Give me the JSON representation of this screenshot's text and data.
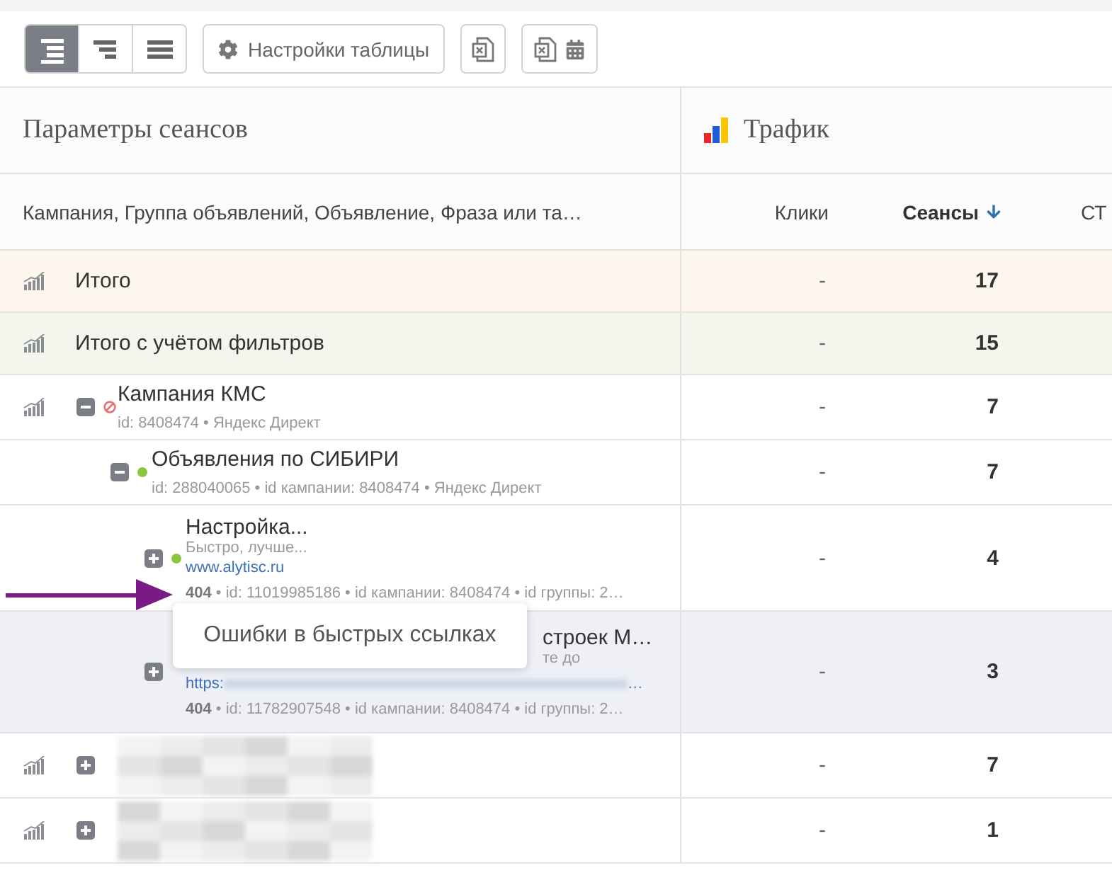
{
  "toolbar": {
    "view_modes": [
      {
        "kind": "tree",
        "selected": true
      },
      {
        "kind": "stepped",
        "selected": false
      },
      {
        "kind": "flat",
        "selected": false
      }
    ],
    "settings_button": "Настройки таблицы",
    "exports": [
      {
        "kind": "excel"
      },
      {
        "kind": "excel_schedule"
      }
    ]
  },
  "table": {
    "group_headers": [
      {
        "kind": "params",
        "label": "Параметры сеансов"
      },
      {
        "kind": "traffic",
        "label": "Трафик"
      }
    ],
    "columns": [
      {
        "label": "Кампания, Группа объявлений, Объявление, Фраза или та…",
        "sorted": false
      },
      {
        "label": "Клики",
        "sorted": false
      },
      {
        "label": "Сеансы",
        "sorted": true
      },
      {
        "label": "СТ",
        "sorted": false
      }
    ],
    "rows": [
      {
        "kind": "total",
        "color": "#fdf6ec",
        "label": "Итого",
        "clicks": "-",
        "sessions": "17"
      },
      {
        "kind": "total",
        "color": "#f3f6ec",
        "label": "Итого с учётом фильтров",
        "clicks": "-",
        "sessions": "15"
      },
      {
        "kind": "campaign",
        "title": "Кампания КМС",
        "meta": "id: 8408474 • Яндекс Директ",
        "stopped": true,
        "expanded": true,
        "highlighted": false,
        "clicks": "-",
        "sessions": "7",
        "children": [
          {
            "kind": "ad_group",
            "title": "Объявления по СИБИРИ",
            "meta": "id: 288040065 • id кампании: 8408474 • Яндекс Директ",
            "stopped": false,
            "expanded": true,
            "highlighted": false,
            "clicks": "-",
            "sessions": "7",
            "children": [
              {
                "kind": "ad",
                "title": "Настройка...",
                "text": "Быстро, лучше...",
                "url": "www.alytisc.ru",
                "meta": "**404** • id: 11019985186 • id кампании: 8408474 • id группы: 2…",
                "stopped": false,
                "expanded": false,
                "highlighted": false,
                "clicks": "-",
                "sessions": "4"
              },
              {
                "kind": "ad",
                "title": "строек М…",
                "text": "те до",
                "url": "https:",
                "url_end": "…",
                "url_blurred": true,
                "meta": "**404** • id: 11782907548 • id кампании: 8408474 • id группы: 2…",
                "expanded": false,
                "highlighted": true,
                "tooltip": "Ошибки в быстрых ссылках",
                "clicks": "-",
                "sessions": "3"
              }
            ]
          }
        ]
      },
      {
        "kind": "redacted",
        "expanded": false,
        "clicks": "-",
        "sessions": "7"
      },
      {
        "kind": "redacted",
        "expanded": false,
        "clicks": "-",
        "sessions": "1"
      }
    ]
  }
}
